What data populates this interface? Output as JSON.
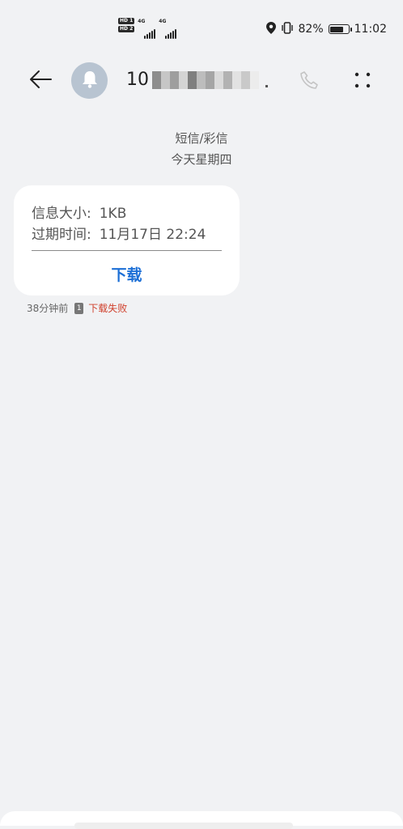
{
  "status_bar": {
    "sim1_tag": "HD 1",
    "sim2_tag": "HD 2",
    "network1": "4G",
    "network2": "4G",
    "battery_percent_text": "82%",
    "battery_level": 0.82,
    "time": "11:02"
  },
  "header": {
    "contact_name_visible": "10"
  },
  "conversation": {
    "message_type": "短信/彩信",
    "date_label": "今天星期四"
  },
  "mms": {
    "size_label": "信息大小:",
    "size_value": "1KB",
    "expiry_label": "过期时间:",
    "expiry_value": "11月17日 22:24",
    "download_label": "下载"
  },
  "message_meta": {
    "time_ago": "38分钟前",
    "sim_slot": "1",
    "status": "下载失败",
    "status_color": "#d0402c"
  },
  "colors": {
    "background": "#f1f2f4",
    "accent": "#1c6fd6",
    "avatar_bg": "#b8c4d1"
  },
  "icons": {
    "back": "arrow-left-icon",
    "avatar": "bell-icon",
    "call": "phone-icon",
    "more": "more-dots-icon",
    "location": "location-icon",
    "vibrate": "vibrate-icon",
    "battery": "battery-icon"
  }
}
